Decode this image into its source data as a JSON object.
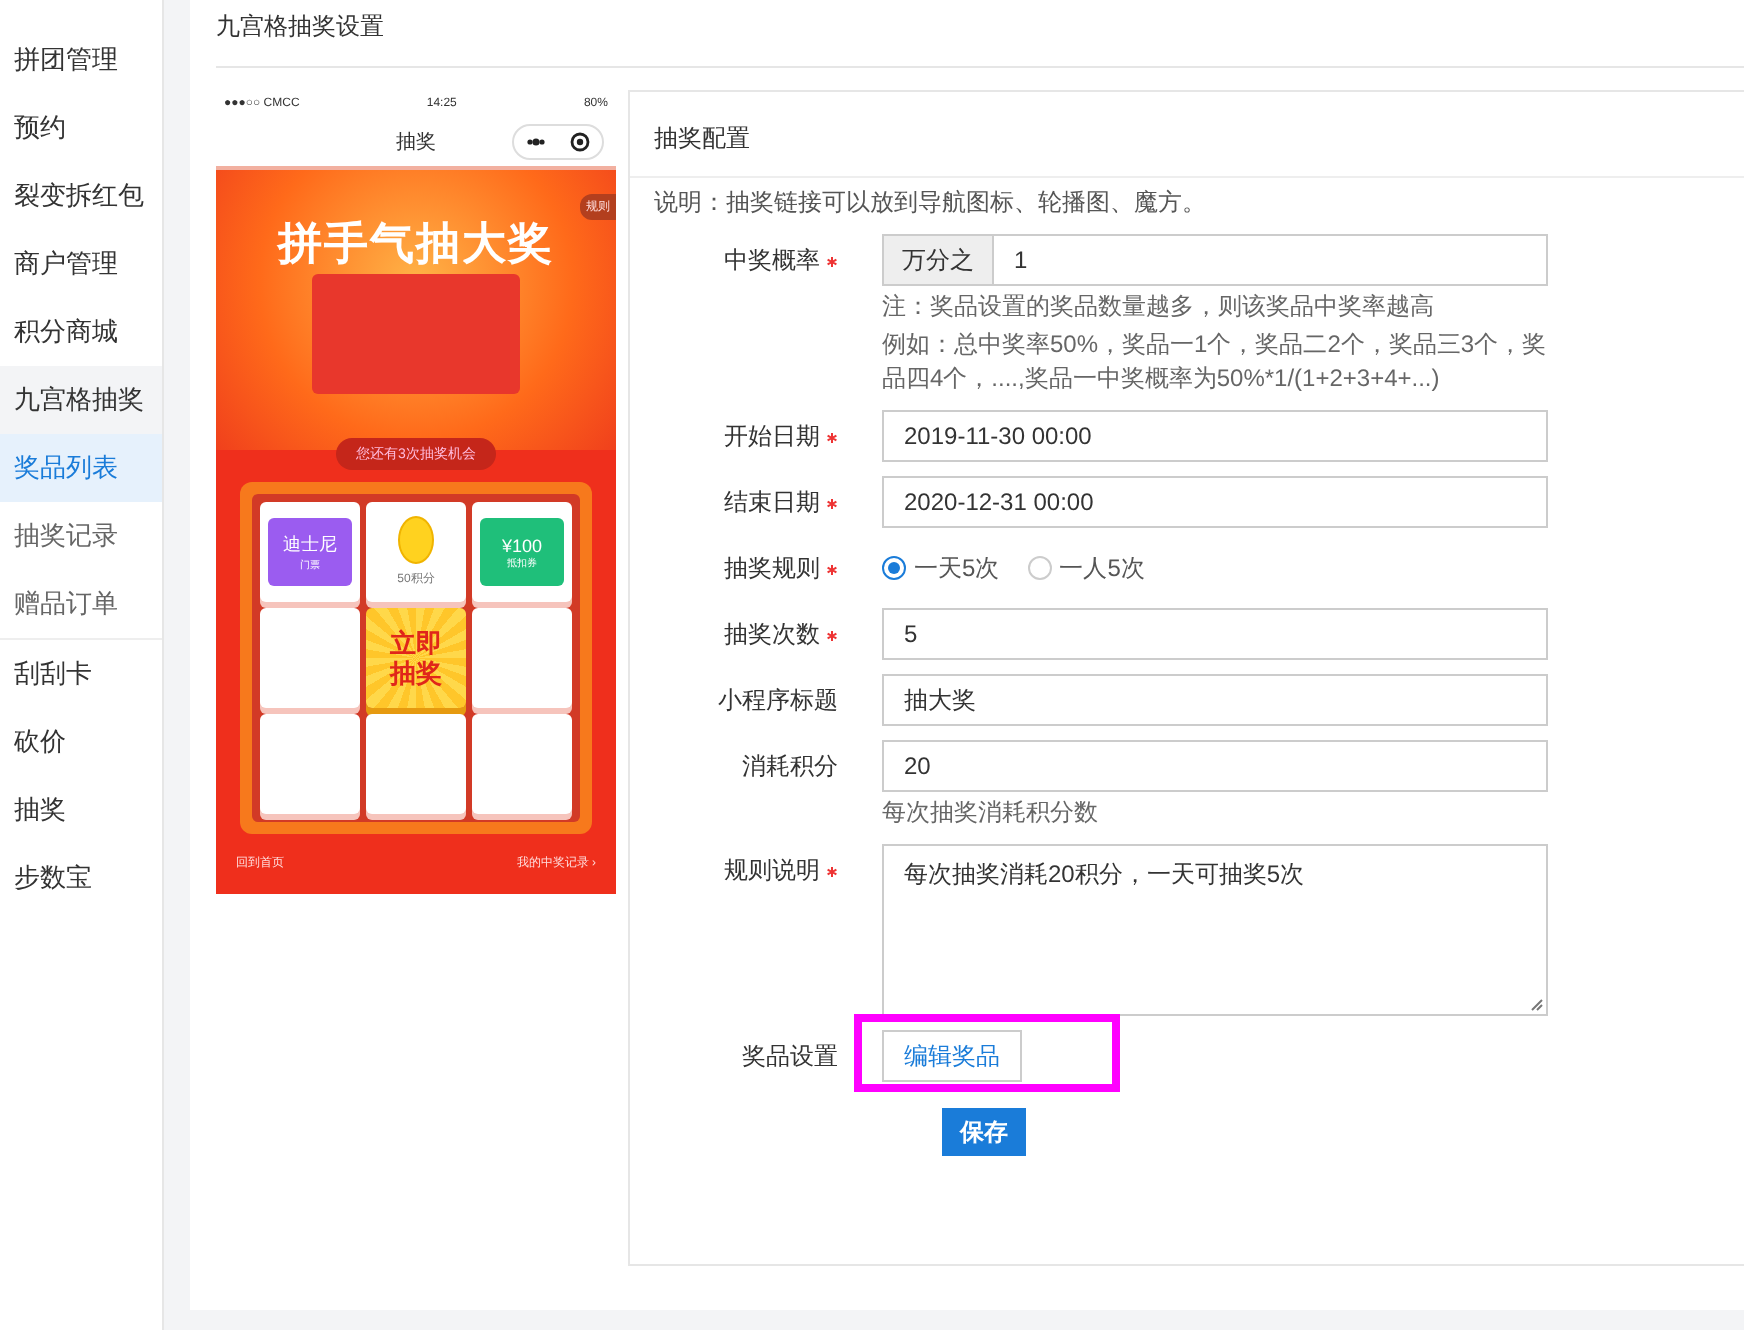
{
  "sidebar": {
    "items": [
      {
        "label": "拼团管理",
        "selected": false,
        "expanded": false
      },
      {
        "label": "预约",
        "selected": false,
        "expanded": false
      },
      {
        "label": "裂变拆红包",
        "selected": false,
        "expanded": false
      },
      {
        "label": "商户管理",
        "selected": false,
        "expanded": false
      },
      {
        "label": "积分商城",
        "selected": false,
        "expanded": false
      },
      {
        "label": "九宫格抽奖",
        "selected": false,
        "expanded": true,
        "children": [
          {
            "label": "奖品列表",
            "selected": true
          },
          {
            "label": "抽奖记录",
            "selected": false
          },
          {
            "label": "赠品订单",
            "selected": false
          }
        ]
      },
      {
        "label": "刮刮卡",
        "selected": false,
        "expanded": false
      },
      {
        "label": "砍价",
        "selected": false,
        "expanded": false
      },
      {
        "label": "抽奖",
        "selected": false,
        "expanded": false
      },
      {
        "label": "步数宝",
        "selected": false,
        "expanded": false
      }
    ]
  },
  "page": {
    "title": "九宫格抽奖设置"
  },
  "phone": {
    "signal": "●●●○○ CMCC",
    "time": "14:25",
    "battery": "80%",
    "title": "抽奖",
    "banner_title": "拼手气抽大奖",
    "rules_badge": "规则",
    "chances": "您还有3次抽奖机会",
    "grid": [
      {
        "kind": "ticket",
        "color": "#9b5cf0",
        "line1": "迪士尼",
        "line2": "门票"
      },
      {
        "kind": "coin",
        "line1": "50积分"
      },
      {
        "kind": "ticket",
        "color": "#1fbf7a",
        "line1": "¥100",
        "line2": "抵扣券"
      },
      {
        "kind": "empty"
      },
      {
        "kind": "draw",
        "line1": "立即",
        "line2": "抽奖"
      },
      {
        "kind": "empty"
      },
      {
        "kind": "empty"
      },
      {
        "kind": "empty"
      },
      {
        "kind": "empty"
      }
    ],
    "footer_left": "回到首页",
    "footer_right": "我的中奖记录 ›"
  },
  "config": {
    "title": "抽奖配置",
    "note": "说明：抽奖链接可以放到导航图标、轮播图、魔方。",
    "fields": [
      {
        "kind": "addon",
        "label": "中奖概率",
        "required": true,
        "addon": "万分之",
        "value": "1",
        "help": [
          "注：奖品设置的奖品数量越多，则该奖品中奖率越高",
          "例如：总中奖率50%，奖品一1个，奖品二2个，奖品三3个，奖品四4个，....,奖品一中奖概率为50%*1/(1+2+3+4+...)"
        ]
      },
      {
        "kind": "text",
        "label": "开始日期",
        "required": true,
        "value": "2019-11-30 00:00"
      },
      {
        "kind": "text",
        "label": "结束日期",
        "required": true,
        "value": "2020-12-31 00:00"
      },
      {
        "kind": "radio",
        "label": "抽奖规则",
        "required": true,
        "options": [
          {
            "label": "一天5次",
            "selected": true
          },
          {
            "label": "一人5次",
            "selected": false
          }
        ]
      },
      {
        "kind": "text",
        "label": "抽奖次数",
        "required": true,
        "value": "5"
      },
      {
        "kind": "text",
        "label": "小程序标题",
        "required": false,
        "value": "抽大奖"
      },
      {
        "kind": "text",
        "label": "消耗积分",
        "required": false,
        "value": "20",
        "help": [
          "每次抽奖消耗积分数"
        ]
      },
      {
        "kind": "textarea",
        "label": "规则说明",
        "required": true,
        "value": "每次抽奖消耗20积分，一天可抽奖5次"
      },
      {
        "kind": "button",
        "label": "奖品设置",
        "required": false,
        "button": "编辑奖品",
        "highlighted": true
      }
    ],
    "save": "保存"
  }
}
